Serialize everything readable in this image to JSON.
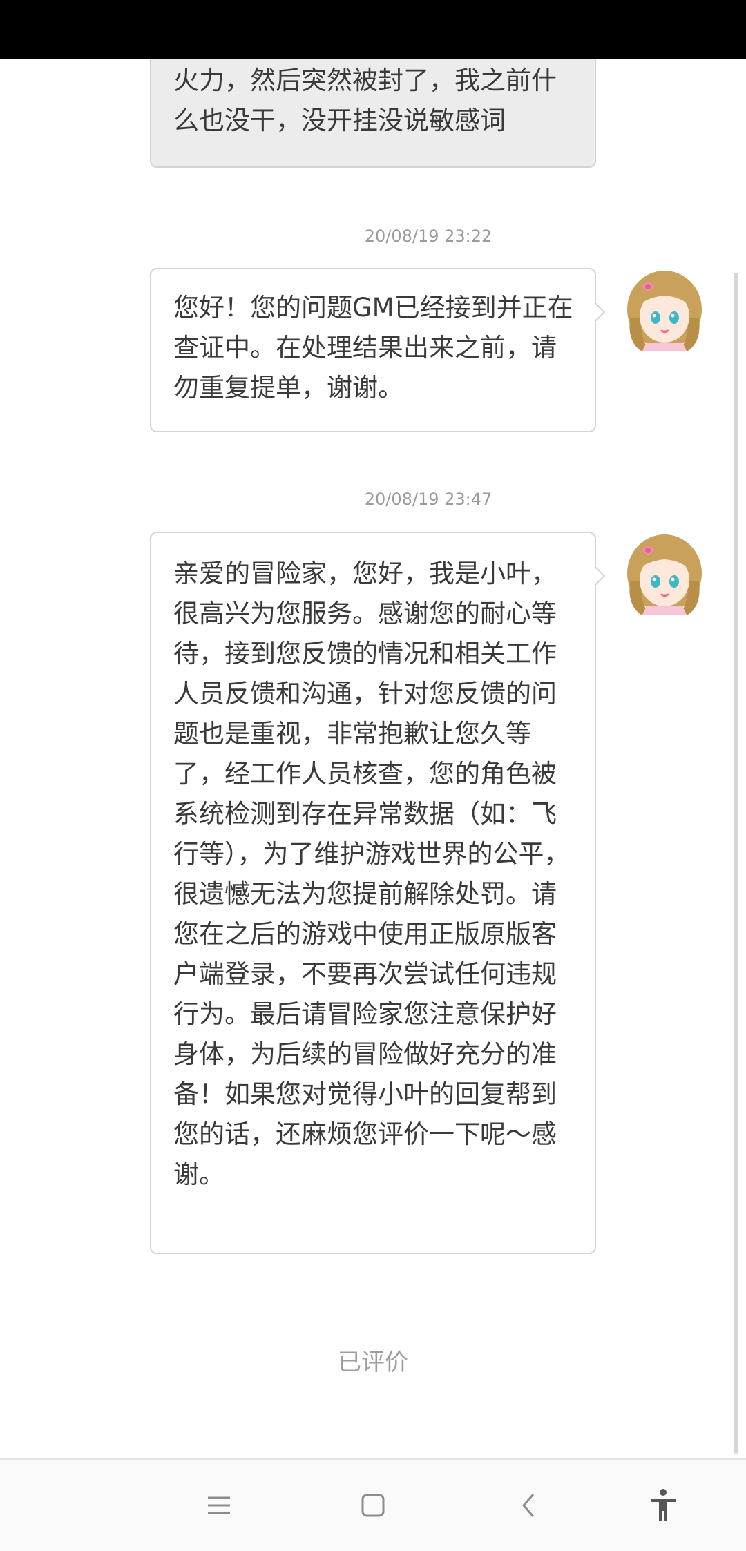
{
  "messages": [
    {
      "sender": "user",
      "text": "火力，然后突然被封了，我之前什么也没干，没开挂没说敏感词"
    },
    {
      "sender": "gm",
      "timestamp": "20/08/19 23:22",
      "text": "您好！您的问题GM已经接到并正在查证中。在处理结果出来之前，请勿重复提单，谢谢。"
    },
    {
      "sender": "gm",
      "timestamp": "20/08/19 23:47",
      "text": "亲爱的冒险家，您好，我是小叶，很高兴为您服务。感谢您的耐心等待，接到您反馈的情况和相关工作人员反馈和沟通，针对您反馈的问题也是重视，非常抱歉让您久等了，经工作人员核查，您的角色被系统检测到存在异常数据（如：飞行等），为了维护游戏世界的公平，很遗憾无法为您提前解除处罚。请您在之后的游戏中使用正版原版客户端登录，不要再次尝试任何违规行为。最后请冒险家您注意保护好身体，为后续的冒险做好充分的准备！如果您对觉得小叶的回复帮到您的话，还麻烦您评价一下呢～感谢。"
    }
  ],
  "rating_status": "已评价",
  "icons": {
    "avatar": "gm-avatar-icon",
    "nav": [
      "menu-icon",
      "home-icon",
      "back-icon",
      "accessibility-icon"
    ]
  },
  "colors": {
    "user_bubble": "#ececec",
    "gm_bubble": "#ffffff",
    "bubble_border": "#d4d4d4",
    "timestamp": "#9b9b9b",
    "status_bar": "#000000"
  }
}
